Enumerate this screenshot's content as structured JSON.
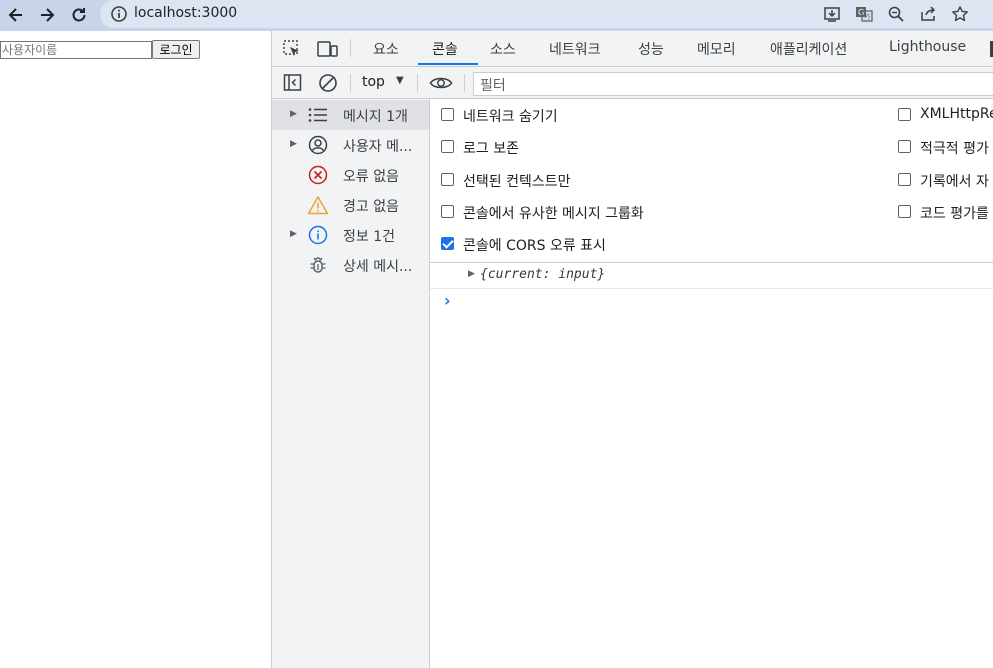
{
  "browser": {
    "url": "localhost:3000",
    "icons": [
      "back-arrow-icon",
      "forward-arrow-icon",
      "reload-icon",
      "info-icon",
      "install-icon",
      "translate-icon",
      "zoom-icon",
      "share-icon",
      "bookmark-star-icon"
    ]
  },
  "page": {
    "username_placeholder": "사용자이름",
    "login_label": "로그인"
  },
  "devtools": {
    "tabs": [
      {
        "label": "요소"
      },
      {
        "label": "콘솔"
      },
      {
        "label": "소스"
      },
      {
        "label": "네트워크"
      },
      {
        "label": "성능"
      },
      {
        "label": "메모리"
      },
      {
        "label": "애플리케이션"
      },
      {
        "label": "Lighthouse"
      }
    ],
    "active_tab": "콘솔",
    "toolbar": {
      "context": "top",
      "filter_placeholder": "필터"
    },
    "sidebar": [
      {
        "label": "메시지 1개",
        "icon": "list-icon"
      },
      {
        "label": "사용자 메...",
        "icon": "user-icon"
      },
      {
        "label": "오류 없음",
        "icon": "error-icon"
      },
      {
        "label": "경고 없음",
        "icon": "warning-icon"
      },
      {
        "label": "정보 1건",
        "icon": "info-icon"
      },
      {
        "label": "상세 메시...",
        "icon": "bug-icon"
      }
    ],
    "settings": [
      {
        "label": "네트워크 숨기기",
        "checked": false
      },
      {
        "label": "로그 보존",
        "checked": false
      },
      {
        "label": "선택된 컨텍스트만",
        "checked": false
      },
      {
        "label": "콘솔에서 유사한 메시지 그룹화",
        "checked": false
      },
      {
        "label": "콘솔에 CORS 오류 표시",
        "checked": true
      },
      {
        "label": "XMLHttpRe",
        "checked": false
      },
      {
        "label": "적극적 평가",
        "checked": false
      },
      {
        "label": "기록에서 자",
        "checked": false
      },
      {
        "label": "코드 평가를",
        "checked": false
      }
    ],
    "log": {
      "message": "{current: input}"
    }
  },
  "colors": {
    "accent": "#1a73e8",
    "error": "#c5221f",
    "warning": "#e8a33d"
  }
}
